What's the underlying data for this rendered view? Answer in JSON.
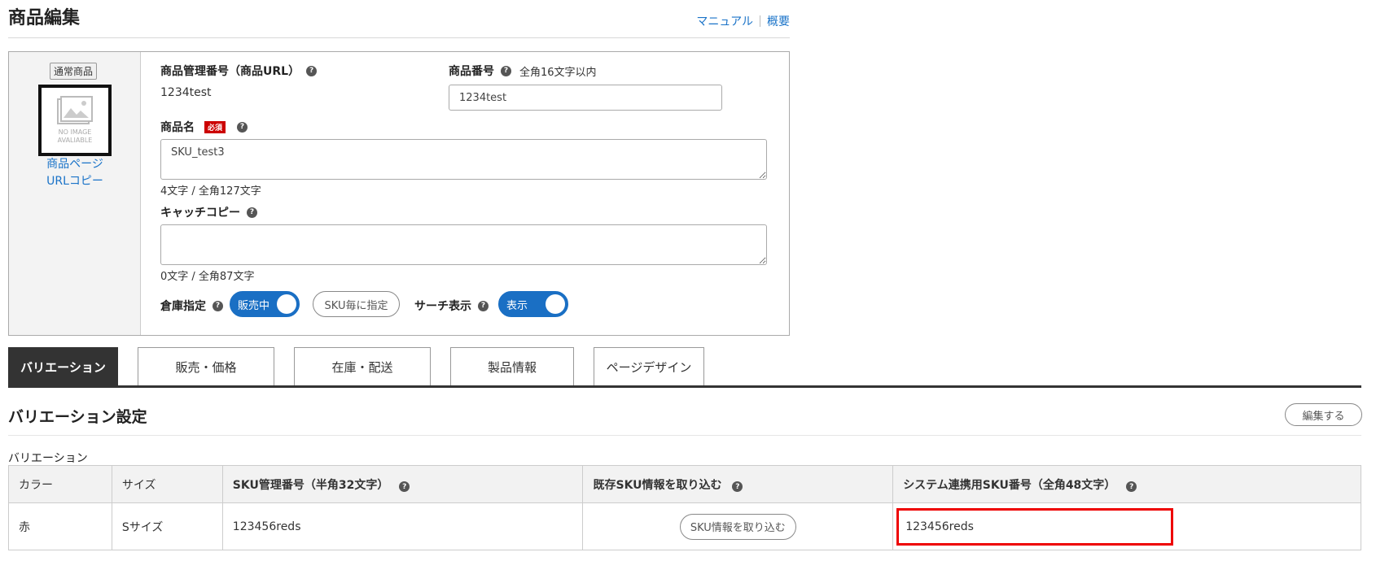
{
  "header": {
    "title": "商品編集",
    "links": {
      "manual": "マニュアル",
      "overview": "概要"
    }
  },
  "product": {
    "badge": "通常商品",
    "noimage_text": "NO IMAGE AVALIABLE",
    "page_link_line1": "商品ページ",
    "page_link_line2": "URLコピー",
    "mgmt_no_label": "商品管理番号（商品URL）",
    "mgmt_no_value": "1234test",
    "item_no_label": "商品番号",
    "item_no_hint": "全角16文字以内",
    "item_no_value": "1234test",
    "name_label": "商品名",
    "required_badge": "必須",
    "name_value": "SKU_test3",
    "name_counter": "4文字 / 全角127文字",
    "catch_label": "キャッチコピー",
    "catch_value": "",
    "catch_counter": "0文字 / 全角87文字",
    "warehouse_label": "倉庫指定",
    "warehouse_toggle": "販売中",
    "sku_specify_button": "SKU毎に指定",
    "search_label": "サーチ表示",
    "search_toggle": "表示"
  },
  "tabs": [
    {
      "label": "バリエーション",
      "active": true
    },
    {
      "label": "販売・価格",
      "active": false
    },
    {
      "label": "在庫・配送",
      "active": false
    },
    {
      "label": "製品情報",
      "active": false
    },
    {
      "label": "ページデザイン",
      "active": false
    }
  ],
  "variation": {
    "section_title": "バリエーション設定",
    "edit_button": "編集する",
    "sub_label": "バリエーション",
    "columns": [
      "カラー",
      "サイズ",
      "SKU管理番号（半角32文字）",
      "既存SKU情報を取り込む",
      "システム連携用SKU番号（全角48文字）"
    ],
    "rows": [
      {
        "color": "赤",
        "size": "Sサイズ",
        "sku_no": "123456reds",
        "import_button": "SKU情報を取り込む",
        "system_sku": "123456reds"
      }
    ]
  },
  "colors": {
    "accent": "#1a6fc4",
    "required": "#cc0000",
    "highlight": "#ee0000"
  },
  "icons": {
    "help": "question-circle-icon",
    "noimage": "image-placeholder-icon"
  }
}
